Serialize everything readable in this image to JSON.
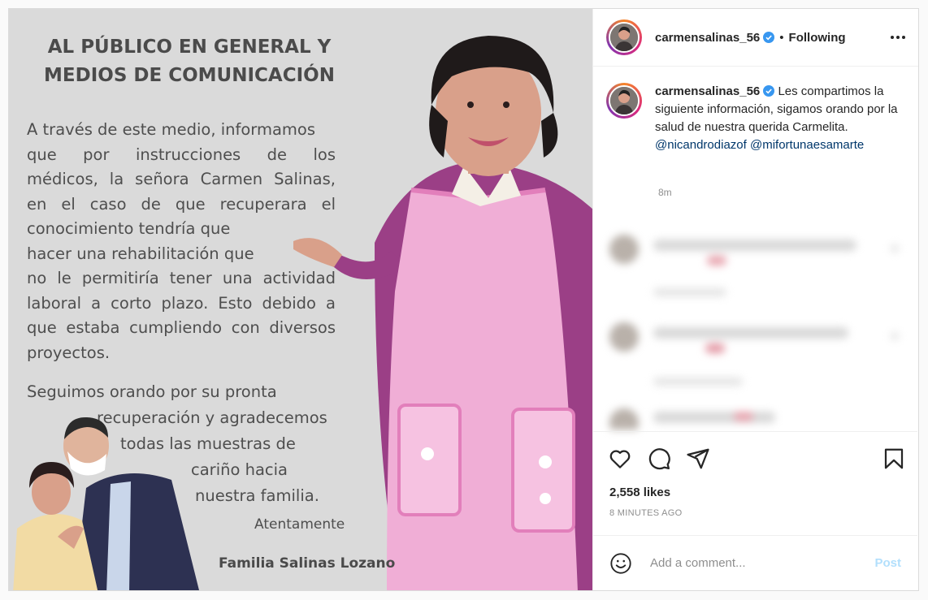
{
  "image": {
    "title_lines": [
      "AL PÚBLICO EN GENERAL Y",
      "MEDIOS DE COMUNICACIÓN"
    ],
    "body_lines": [
      "A través de este medio, informamos",
      "que por instrucciones de los",
      "médicos, la señora Carmen Salinas,",
      "en el caso de que recuperara el",
      "conocimiento tendría que",
      "hacer una rehabilitación que",
      "no le permitiría tener una actividad",
      "laboral a corto plazo. Esto debido a",
      "que estaba cumpliendo con diversos",
      "proyectos."
    ],
    "thanks_lines": [
      "Seguimos orando por su pronta",
      "recuperación y agradecemos",
      "todas las muestras de",
      "cariño hacia",
      "nuestra familia."
    ],
    "regards": "Atentamente",
    "signature": "Familia Salinas Lozano"
  },
  "header": {
    "username": "carmensalinas_56",
    "separator": "•",
    "follow_status": "Following"
  },
  "caption": {
    "username": "carmensalinas_56",
    "text": "Les compartimos la siguiente información, sigamos orando por la salud de nuestra querida Carmelita.",
    "mentions": [
      "@nicandrodiazof",
      "@mifortunaesamarte"
    ],
    "time": "8m"
  },
  "stats": {
    "likes": "2,558 likes",
    "posted": "8 MINUTES AGO"
  },
  "comment_box": {
    "placeholder": "Add a comment...",
    "post_label": "Post"
  },
  "icons": [
    "heart-icon",
    "comment-icon",
    "share-icon",
    "bookmark-icon",
    "emoji-icon",
    "verified-icon",
    "more-icon"
  ],
  "colors": {
    "verified": "#3897f0",
    "mention": "#00376b",
    "post_button_disabled": "#b2dffc",
    "image_background": "#dadada",
    "apron_pink": "#f0aed6",
    "dress_purple": "#9b3f86"
  }
}
